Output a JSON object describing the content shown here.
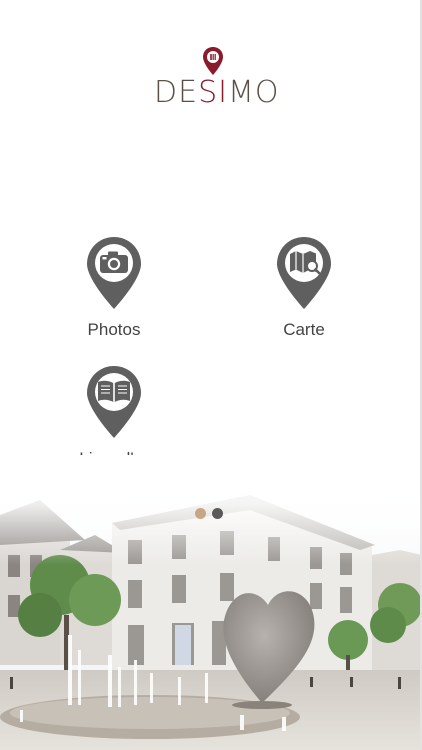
{
  "app": {
    "logo_text_1": "DE",
    "logo_text_2": "SI",
    "logo_text_3": "MO"
  },
  "menu": {
    "photos": {
      "label": "Photos",
      "icon": "camera-icon"
    },
    "map": {
      "label": "Carte",
      "icon": "map-search-icon"
    },
    "guestbook": {
      "label": "Livre d'or",
      "icon": "open-book-icon"
    }
  },
  "pager": {
    "count": 2,
    "active_index": 0
  },
  "colors": {
    "pin": "#5f5f5f",
    "brand_red": "#8a1b2c",
    "dot_active": "#c7a685",
    "dot_inactive": "#5a5a5a",
    "label": "#444444"
  }
}
